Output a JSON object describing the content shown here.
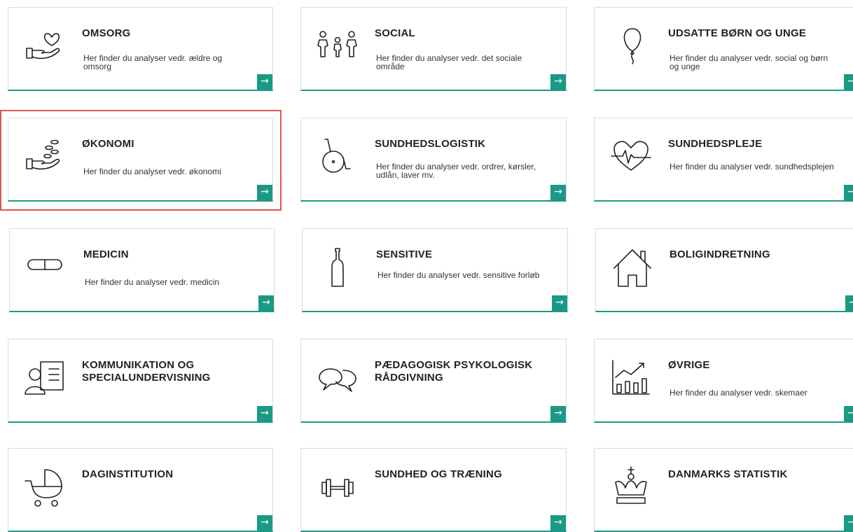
{
  "colors": {
    "accent": "#1a9a84",
    "highlight": "#e05454",
    "border": "#dcdcdc"
  },
  "arrow_glyph": "→",
  "tiles": [
    {
      "title": "OMSORG",
      "desc": "Her finder du analyser vedr. ældre og omsorg",
      "icon": "heart-hand-icon"
    },
    {
      "title": "SOCIAL",
      "desc": "Her finder du analyser vedr. det sociale område",
      "icon": "family-icon"
    },
    {
      "title": "UDSATTE BØRN OG UNGE",
      "desc": "Her finder du analyser vedr. social og børn og unge",
      "icon": "balloon-icon"
    },
    {
      "title": "ØKONOMI",
      "desc": "Her finder du analyser vedr. økonomi",
      "icon": "coins-hand-icon"
    },
    {
      "title": "SUNDHEDSLOGISTIK",
      "desc": "Her finder du analyser vedr. ordrer, kørsler, udlån, laver mv.",
      "icon": "wheelchair-icon"
    },
    {
      "title": "SUNDHEDSPLEJE",
      "desc": "Her finder du analyser vedr. sundhedsplejen",
      "icon": "heartbeat-icon"
    },
    {
      "title": "MEDICIN",
      "desc": "Her finder du analyser vedr. medicin",
      "icon": "pill-icon"
    },
    {
      "title": "SENSITIVE",
      "desc": "Her finder du analyser vedr. sensitive forløb",
      "icon": "bottle-icon"
    },
    {
      "title": "BOLIGINDRETNING",
      "desc": "",
      "icon": "house-icon"
    },
    {
      "title": "KOMMUNIKATION OG SPECIALUNDERVISNING",
      "desc": "",
      "icon": "teacher-board-icon"
    },
    {
      "title": "PÆDAGOGISK PSYKOLOGISK RÅDGIVNING",
      "desc": "",
      "icon": "speech-bubbles-icon"
    },
    {
      "title": "ØVRIGE",
      "desc": "Her finder du analyser vedr. skemaer",
      "icon": "bar-chart-icon"
    },
    {
      "title": "DAGINSTITUTION",
      "desc": "",
      "icon": "stroller-icon"
    },
    {
      "title": "SUNDHED OG TRÆNING",
      "desc": "",
      "icon": "dumbbell-icon"
    },
    {
      "title": "DANMARKS STATISTIK",
      "desc": "",
      "icon": "crown-icon"
    }
  ]
}
